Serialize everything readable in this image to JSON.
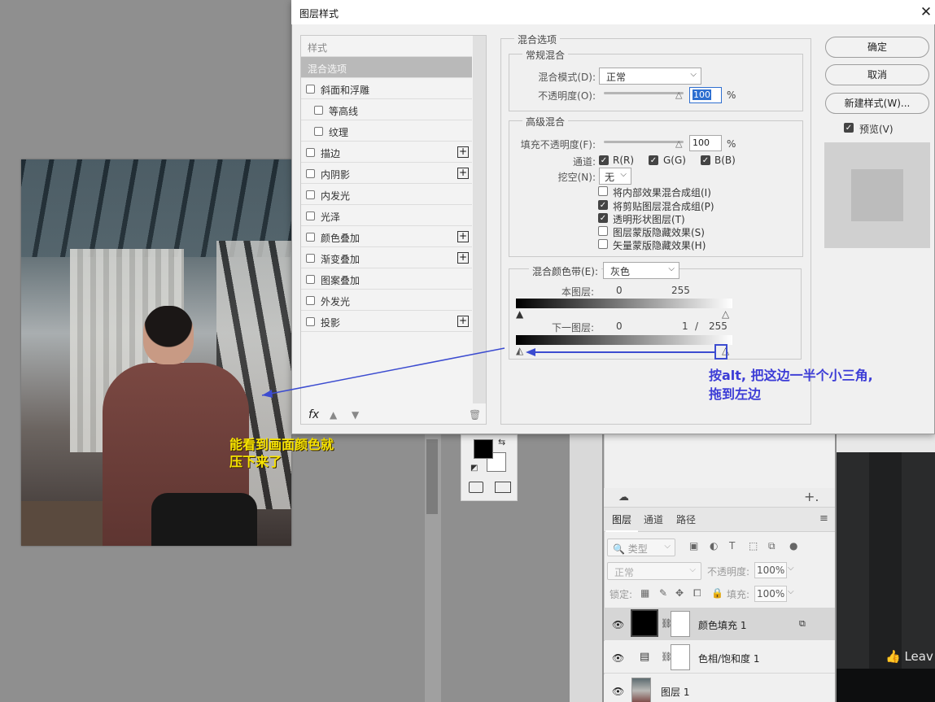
{
  "dialog": {
    "title": "图层样式",
    "close_glyph": "✕",
    "styles_list": [
      {
        "label": "样式",
        "type": "header"
      },
      {
        "label": "混合选项",
        "type": "selected"
      },
      {
        "label": "斜面和浮雕",
        "checkbox": true,
        "indent": false,
        "plus": false
      },
      {
        "label": "等高线",
        "checkbox": true,
        "indent": true,
        "plus": false
      },
      {
        "label": "纹理",
        "checkbox": true,
        "indent": true,
        "plus": false
      },
      {
        "label": "描边",
        "checkbox": true,
        "indent": false,
        "plus": true
      },
      {
        "label": "内阴影",
        "checkbox": true,
        "indent": false,
        "plus": true
      },
      {
        "label": "内发光",
        "checkbox": true,
        "indent": false,
        "plus": false
      },
      {
        "label": "光泽",
        "checkbox": true,
        "indent": false,
        "plus": false
      },
      {
        "label": "颜色叠加",
        "checkbox": true,
        "indent": false,
        "plus": true
      },
      {
        "label": "渐变叠加",
        "checkbox": true,
        "indent": false,
        "plus": true
      },
      {
        "label": "图案叠加",
        "checkbox": true,
        "indent": false,
        "plus": false
      },
      {
        "label": "外发光",
        "checkbox": true,
        "indent": false,
        "plus": false
      },
      {
        "label": "投影",
        "checkbox": true,
        "indent": false,
        "plus": true
      }
    ],
    "plus_glyph": "+",
    "fx_label": "fx",
    "up_glyph": "▲",
    "down_glyph": "▼",
    "trash_glyph": "🗑",
    "blend_options": {
      "legend": "混合选项",
      "general": {
        "legend": "常规混合",
        "mode_label": "混合模式(D):",
        "mode_value": "正常",
        "opacity_label": "不透明度(O):",
        "opacity_value": "100",
        "pct": "%"
      },
      "advanced": {
        "legend": "高级混合",
        "fill_label": "填充不透明度(F):",
        "fill_value": "100",
        "pct": "%",
        "channels_label": "通道:",
        "channels": [
          "R(R)",
          "G(G)",
          "B(B)"
        ],
        "knockout_label": "挖空(N):",
        "knockout_value": "无",
        "options": [
          {
            "label": "将内部效果混合成组(I)",
            "checked": false
          },
          {
            "label": "将剪贴图层混合成组(P)",
            "checked": true
          },
          {
            "label": "透明形状图层(T)",
            "checked": true
          },
          {
            "label": "图层蒙版隐藏效果(S)",
            "checked": false
          },
          {
            "label": "矢量蒙版隐藏效果(H)",
            "checked": false
          }
        ]
      },
      "blend_if": {
        "label": "混合颜色带(E):",
        "value": "灰色",
        "this_layer_label": "本图层:",
        "this_layer_low": "0",
        "this_layer_high": "255",
        "underlying_label": "下一图层:",
        "underlying_low": "0",
        "underlying_mid": "1",
        "underlying_sep": "/",
        "underlying_high": "255"
      }
    },
    "buttons": {
      "ok": "确定",
      "cancel": "取消",
      "new_style": "新建样式(W)...",
      "preview_label": "预览(V)"
    }
  },
  "layers_panel": {
    "tabs": [
      "图层",
      "通道",
      "路径"
    ],
    "filter_placeholder": "类型",
    "blend_mode": "正常",
    "opacity_label": "不透明度:",
    "opacity_value": "100%",
    "lock_label": "锁定:",
    "fill_label": "填充:",
    "fill_value": "100%",
    "layers": [
      {
        "name": "颜色填充 1",
        "selected": true
      },
      {
        "name": "色相/饱和度 1",
        "selected": false
      },
      {
        "name": "图层 1",
        "selected": false
      }
    ],
    "menu_glyph": "≡",
    "add_glyph": "+."
  },
  "right_panel": {
    "leave_label": "👍 Leav"
  },
  "annotations": {
    "left_note": "能看到画面颜色就\n压下来了",
    "right_note": "按alt, 把这边一半个小三角,\n拖到左边",
    "color_left": "#f7e300",
    "color_right": "#3c3cd6"
  }
}
